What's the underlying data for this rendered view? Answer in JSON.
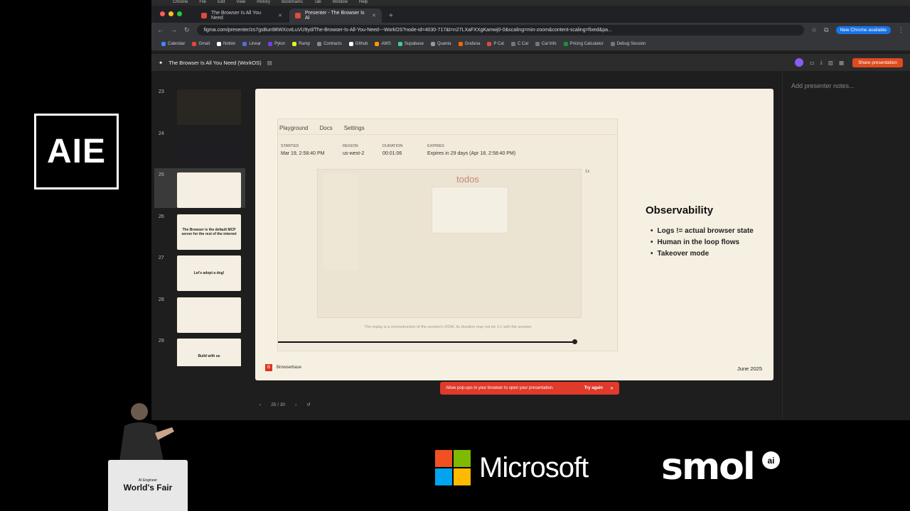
{
  "event_logo": "AIE",
  "mac_menu": [
    "Chrome",
    "File",
    "Edit",
    "View",
    "History",
    "Bookmarks",
    "Tab",
    "Window",
    "Help"
  ],
  "tabs": [
    {
      "label": "The Browser Is All You Need"
    },
    {
      "label": "Presenter - The Browser Is Al"
    }
  ],
  "url": "figma.com/presenter/zs7gsBun98WXcvtLuVU9yd/The-Browser-Is-All-You-Need---WorkOS?node-id=4030-717&t=n27LXaFXXgKamwj0-0&scaling=min-zoom&content-scaling=fixed&pa...",
  "chrome_update": "New Chrome available",
  "bookmarks": [
    {
      "label": "Calendar",
      "color": "#4285f4"
    },
    {
      "label": "Gmail",
      "color": "#ea4335"
    },
    {
      "label": "Notion",
      "color": "#ffffff"
    },
    {
      "label": "Linear",
      "color": "#5e6ad2"
    },
    {
      "label": "Pylon",
      "color": "#7c3aed"
    },
    {
      "label": "Ramp",
      "color": "#e4f222"
    },
    {
      "label": "Contracts",
      "color": "#888888"
    },
    {
      "label": "Github",
      "color": "#ffffff"
    },
    {
      "label": "AWS",
      "color": "#ff9900"
    },
    {
      "label": "Supabase",
      "color": "#3ecf8e"
    },
    {
      "label": "Quanta",
      "color": "#999999"
    },
    {
      "label": "Grafana",
      "color": "#f46800"
    },
    {
      "label": "P Cal",
      "color": "#e04a3f"
    },
    {
      "label": "C Cal",
      "color": "#777777"
    },
    {
      "label": "Cal Info",
      "color": "#777777"
    },
    {
      "label": "Pricing Calculator",
      "color": "#1e8e3e"
    },
    {
      "label": "Debug Session",
      "color": "#777777"
    }
  ],
  "figma": {
    "file_title": "The Browser Is All You Need (WorkOS)",
    "share_label": "Share presentation",
    "notes_placeholder": "Add presenter notes..."
  },
  "thumbnails": [
    {
      "num": "23",
      "text": ""
    },
    {
      "num": "24",
      "text": ""
    },
    {
      "num": "25",
      "text": ""
    },
    {
      "num": "26",
      "text": "The Browser is the default MCP server for the rest of the internet"
    },
    {
      "num": "27",
      "text": "Let's adopt a dog!"
    },
    {
      "num": "28",
      "text": ""
    },
    {
      "num": "29",
      "text": "Build with us"
    }
  ],
  "slide": {
    "playground_tabs": [
      "Playground",
      "Docs",
      "Settings"
    ],
    "meta": [
      {
        "label": "STARTED",
        "value": "Mar 19, 2:58:40 PM"
      },
      {
        "label": "REGION",
        "value": "us-west-2"
      },
      {
        "label": "DURATION",
        "value": "00:01:06"
      },
      {
        "label": "EXPIRES",
        "value": "Expires in 29 days (Apr 18, 2:58:40 PM)"
      }
    ],
    "todos_title": "todos",
    "todos_badge": "1x",
    "replay_note": "The replay is a reconstruction of the session's DOM. Its duration may not be 1:1 with the session.",
    "heading": "Observability",
    "bullets": [
      "Logs != actual browser state",
      "Human in the loop flows",
      "Takeover mode"
    ],
    "brand": "Browserbase",
    "date": "June 2025"
  },
  "popup": {
    "message": "Allow pop-ups in your browser to open your presentation.",
    "action": "Try again"
  },
  "pager": "25 / 30",
  "podium": {
    "line1": "AI Engineer",
    "line2": "World's Fair"
  },
  "sponsors": {
    "microsoft": "Microsoft",
    "smol": "smol",
    "smol_badge": "ai"
  }
}
